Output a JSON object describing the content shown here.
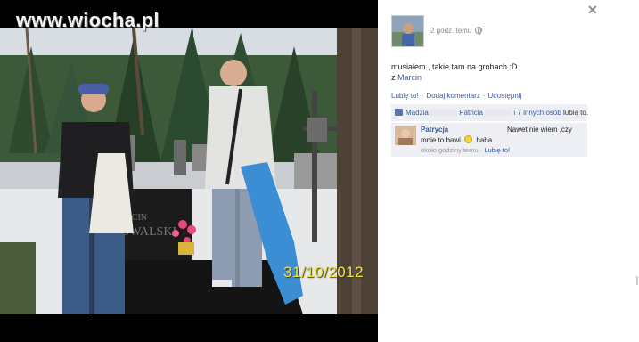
{
  "watermark": "www.wiocha.pl",
  "photo": {
    "date_stamp": "31/10/2012",
    "grave_text_1": "MARCIN",
    "grave_text_2": "KOWALSKI"
  },
  "post": {
    "time": "2 godz. temu",
    "caption": "musiałem , takie tam na grobach :D",
    "with_prefix": "z",
    "with_name": "Marcin",
    "actions": [
      "Lubię to!",
      "Dodaj komentarz",
      "Udostępnij"
    ]
  },
  "likes": {
    "name_1": "Madzia",
    "name_2": "Patricia",
    "others_link": "i 7 innych osób",
    "suffix": "lubią to."
  },
  "comment": {
    "author": "Patrycja",
    "text_part1": "Nawet nie wiem ,czy",
    "text_part2": "mnie to bawi",
    "text_part3": "haha",
    "time": "około godziny temu",
    "sep": "·",
    "like_link": "Lubię to!"
  },
  "icons": {
    "close": "close-icon",
    "privacy": "globe-icon",
    "like": "thumbs-up-icon",
    "smiley": "smiley-icon"
  },
  "colors": {
    "link": "#3b5998",
    "panel_bg": "#edeff4",
    "date_stamp": "#f3e23a"
  }
}
